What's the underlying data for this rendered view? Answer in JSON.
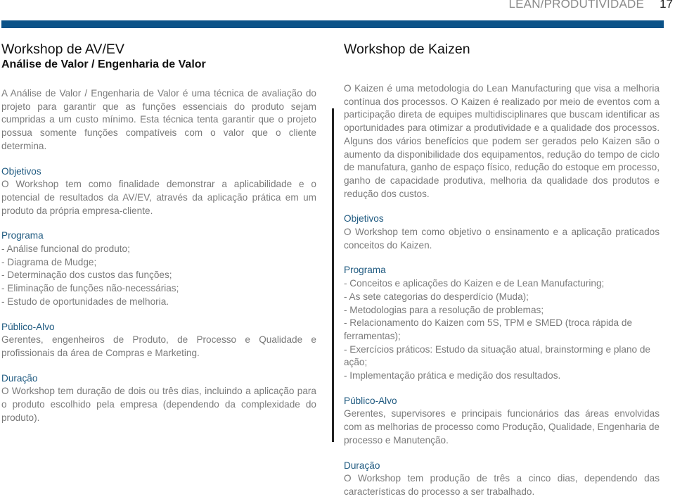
{
  "header": {
    "section": "LEAN/PRODUTIVIDADE",
    "page_number": "17",
    "bar_color": "#0b5288"
  },
  "left": {
    "title": "Workshop de AV/EV",
    "subtitle": "Análise de Valor / Engenharia de Valor",
    "intro": "A Análise de Valor / Engenharia de Valor é uma técnica de avaliação do projeto para garantir que as funções essenciais do produto sejam cumpridas a um custo mínimo. Esta técnica tenta garantir que o projeto possua somente funções compatíveis com o valor que o cliente determina.",
    "objetivos": {
      "heading": "Objetivos",
      "text": "O Workshop tem como finalidade demonstrar a aplicabilidade e o potencial de resultados da AV/EV, através da aplicação prática em um produto da própria empresa-cliente."
    },
    "programa": {
      "heading": "Programa",
      "items": [
        "- Análise funcional do produto;",
        "- Diagrama de Mudge;",
        "- Determinação dos custos das funções;",
        "- Eliminação de funções não-necessárias;",
        "- Estudo de oportunidades de melhoria."
      ]
    },
    "publico": {
      "heading": "Público-Alvo",
      "text": "Gerentes, engenheiros de Produto, de Processo e Qualidade e profissionais da área de Compras e Marketing."
    },
    "duracao": {
      "heading": "Duração",
      "text": "O Workshop tem duração de dois ou três dias, incluindo a aplicação para o produto escolhido pela empresa (dependendo da complexidade do produto)."
    }
  },
  "right": {
    "title": "Workshop de Kaizen",
    "intro": "O Kaizen é uma metodologia do Lean Manufacturing que visa a melhoria contínua dos processos. O Kaizen é realizado por meio de eventos com a participação direta de equipes multidisciplinares que buscam identificar as oportunidades para otimizar a produtividade e a qualidade dos processos. Alguns dos vários benefícios que podem ser gerados pelo Kaizen são o aumento da disponibilidade dos equipamentos, redução do tempo de ciclo de manufatura, ganho de espaço físico, redução do estoque em processo, ganho de capacidade produtiva, melhoria da qualidade dos produtos e redução dos custos.",
    "objetivos": {
      "heading": "Objetivos",
      "text": "O Workshop tem como objetivo o ensinamento e a aplicação praticados conceitos do Kaizen."
    },
    "programa": {
      "heading": "Programa",
      "items": [
        "- Conceitos e aplicações do Kaizen e de Lean Manufacturing;",
        "- As sete categorias do desperdício (Muda);",
        "- Metodologias para a resolução de problemas;",
        "- Relacionamento do Kaizen com 5S, TPM e SMED (troca rápida de ferramentas);",
        "- Exercícios práticos: Estudo da situação atual, brainstorming e plano de ação;",
        "- Implementação prática e medição dos resultados."
      ]
    },
    "publico": {
      "heading": "Público-Alvo",
      "text": "Gerentes, supervisores e principais funcionários das áreas envolvidas com as melhorias de processo como Produção, Qualidade, Engenharia de processo e Manutenção."
    },
    "duracao": {
      "heading": "Duração",
      "text": "O Workshop tem produção de três a cinco dias, dependendo das características do processo a ser trabalhado."
    }
  }
}
